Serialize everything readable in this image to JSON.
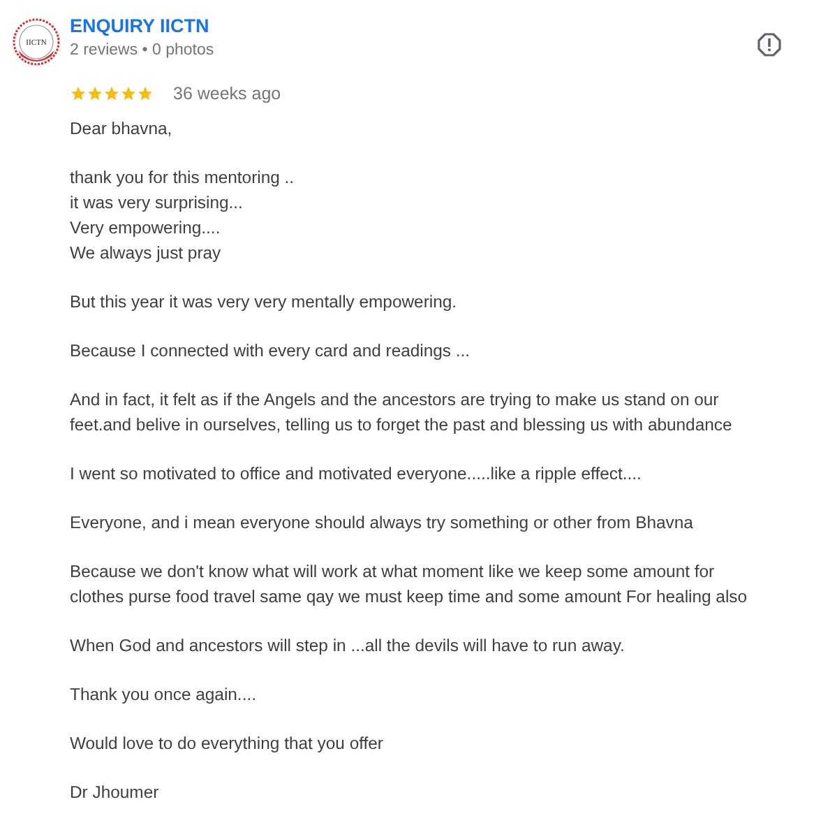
{
  "review": {
    "logo_text": "IICTN",
    "author": "ENQUIRY IICTN",
    "meta": "2 reviews • 0 photos",
    "stars": 5,
    "time": "36 weeks ago",
    "paragraphs": [
      [
        "Dear bhavna,"
      ],
      [
        "thank you for this mentoring ..",
        "it was very surprising...",
        "Very empowering....",
        "We always just pray"
      ],
      [
        "But this year it was very very mentally empowering."
      ],
      [
        "Because I connected with every card and readings ..."
      ],
      [
        "And in fact, it felt as if the Angels and the ancestors are trying to make us stand on our",
        "feet.and belive in ourselves, telling us to forget the past and blessing us with abundance"
      ],
      [
        "I went so motivated to office and motivated everyone.....like a ripple effect...."
      ],
      [
        "Everyone, and i mean everyone should always try something or other from Bhavna"
      ],
      [
        "Because we don't know what will work at what moment like we keep some amount for",
        "clothes purse food travel same qay we must keep time and some amount For healing also"
      ],
      [
        "When God and ancestors will step in ...all the devils will have to run away."
      ],
      [
        "Thank you once again...."
      ],
      [
        "Would love to do everything that you offer"
      ],
      [
        "Dr Jhoumer"
      ]
    ]
  }
}
